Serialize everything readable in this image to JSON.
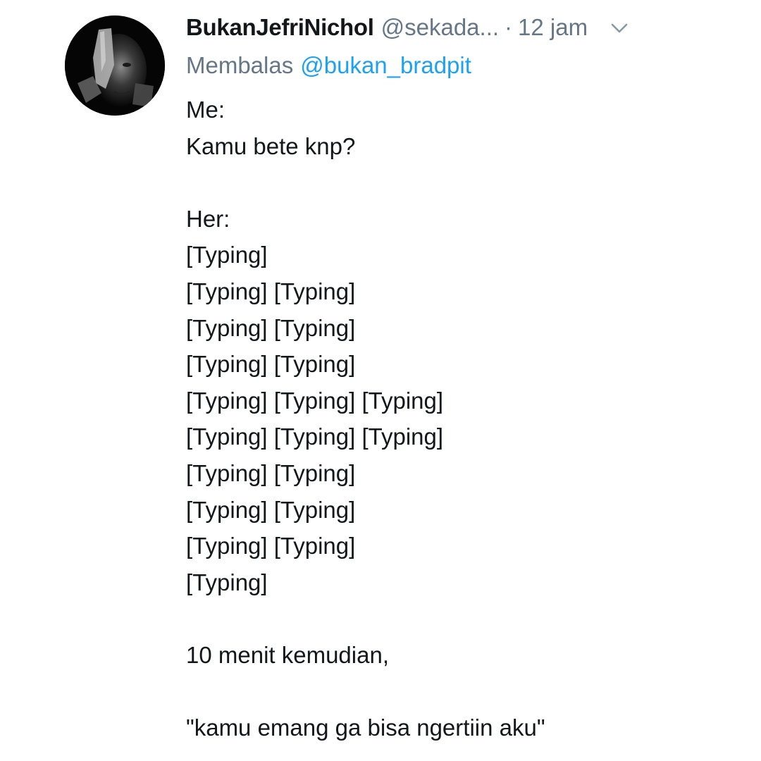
{
  "tweet": {
    "display_name": "BukanJefriNichol",
    "handle": "@sekada...",
    "separator": "·",
    "time": "12 jam",
    "reply_prefix": "Membalas",
    "reply_target": "@bukan_bradpit",
    "lines": [
      "Me:",
      "Kamu bete knp?",
      "",
      "Her:",
      "[Typing]",
      "[Typing] [Typing]",
      "[Typing] [Typing]",
      "[Typing] [Typing]",
      "[Typing] [Typing] [Typing]",
      "[Typing] [Typing] [Typing]",
      "[Typing] [Typing]",
      "[Typing] [Typing]",
      "[Typing] [Typing]",
      "[Typing]",
      "",
      "10 menit kemudian,",
      "",
      "\"kamu emang ga bisa ngertiin aku\""
    ]
  },
  "colors": {
    "primary_text": "#14171a",
    "secondary_text": "#657786",
    "link": "#1da1f2"
  },
  "icons": {
    "more": "chevron-down-icon",
    "avatar": "avatar"
  }
}
